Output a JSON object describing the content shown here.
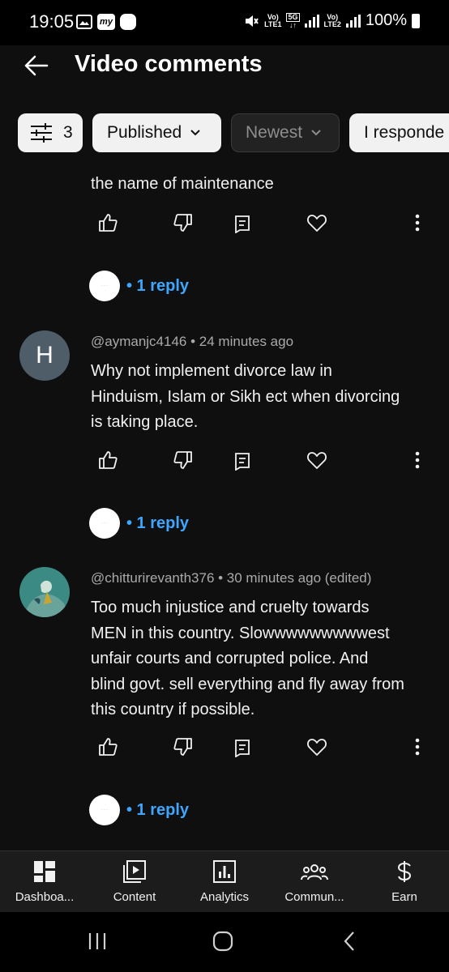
{
  "status_bar": {
    "time": "19:05",
    "network_1_top": "Vo)",
    "network_1_bottom": "LTE1",
    "network_badge": "5G",
    "network_2_top": "Vo)",
    "network_2_bottom": "LTE2",
    "battery": "100%"
  },
  "header": {
    "title": "Video comments"
  },
  "filters": {
    "count": "3",
    "published": "Published",
    "newest": "Newest",
    "responded": "I responde"
  },
  "comments": [
    {
      "partial_top": "the name of maintenance",
      "replies": "• 1 reply"
    },
    {
      "avatar_letter": "H",
      "author": "@aymanjc4146",
      "time": " • 24 minutes ago",
      "text_lines": [
        "Why not implement divorce law in",
        "Hinduism, Islam or Sikh ect when divorcing",
        "is taking place."
      ],
      "replies": "• 1 reply"
    },
    {
      "author": "@chitturirevanth376",
      "time": " • 30 minutes ago (edited)",
      "text_lines": [
        "Too much injustice and cruelty towards",
        "MEN in this country. Slowwwwwwwwwest",
        "unfair courts and corrupted police. And",
        "blind govt. sell everything and fly away from",
        "this country if possible."
      ],
      "replies": "• 1 reply"
    }
  ],
  "bottom_nav": [
    {
      "label": "Dashboa...",
      "icon": "dashboard-icon"
    },
    {
      "label": "Content",
      "icon": "content-icon"
    },
    {
      "label": "Analytics",
      "icon": "analytics-icon"
    },
    {
      "label": "Commun...",
      "icon": "community-icon"
    },
    {
      "label": "Earn",
      "icon": "dollar-icon"
    }
  ],
  "colors": {
    "accent": "#3ea6ff",
    "background": "#0f0f0f"
  }
}
